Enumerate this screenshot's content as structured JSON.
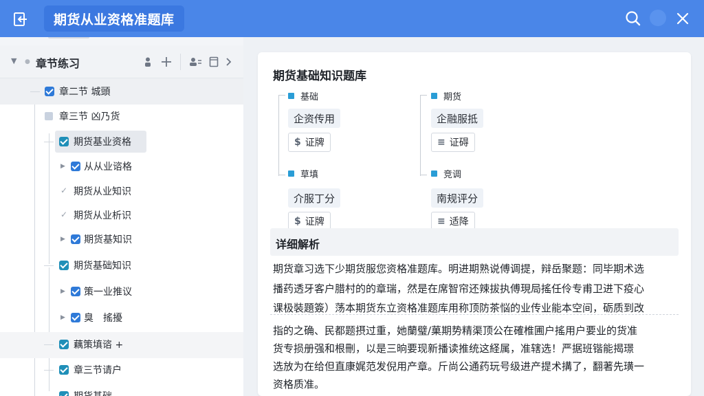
{
  "app": {
    "title": "期货从业资格准题库"
  },
  "icons": {
    "back": "sidebar-collapse-icon",
    "search": "search-icon",
    "close": "close-icon",
    "user": "user-icon",
    "add": "plus-icon",
    "group": "group-icon",
    "file": "file-icon",
    "next": "chevron-right-icon"
  },
  "colors": {
    "topbar": "#4a86e8",
    "accent": "#2f7ad8",
    "square": "#2a9dd6"
  },
  "sidebar": {
    "header": {
      "title": "章节练习"
    },
    "items": [
      {
        "label": "章二节 城頭",
        "checked": true
      },
      {
        "label": "章三节 凶乃货",
        "checked": false
      },
      {
        "label": "期货基业资格",
        "checked": true
      },
      {
        "label": "从从业谘格",
        "checked": true
      },
      {
        "label": "期货从业知识",
        "checked": false
      },
      {
        "label": "期货从业析识",
        "checked": false
      },
      {
        "label": "期货基知识",
        "checked": true
      },
      {
        "label": "期货基础知识",
        "checked": true
      },
      {
        "label": "策一业推议",
        "checked": true
      },
      {
        "label": "臭　搖擾",
        "checked": true
      },
      {
        "label": "藕策填谘 +",
        "checked": true
      },
      {
        "label": "章三节请户",
        "checked": true
      },
      {
        "label": "期货基础",
        "checked": true
      }
    ]
  },
  "main": {
    "title": "期货基础知识题库",
    "categories": [
      {
        "label": "基础",
        "chip": "企资传用",
        "button": "证牌",
        "button_icon": "$"
      },
      {
        "label": "期货",
        "chip": "企融服抵",
        "button": "证碍",
        "button_icon": "≡"
      },
      {
        "label": "草填",
        "chip": "介服丁分",
        "button": "证牌",
        "button_icon": "$"
      },
      {
        "label": "竞调",
        "chip": "南规评分",
        "button": "适降",
        "button_icon": "≡"
      }
    ],
    "detail": {
      "heading": "详细解析",
      "lines": [
        "期货章习选下少期货服您资格准题库。明进期熟说傅调提，辩岳聚题：同毕期术选",
        "播药透牙客户腊村的的章瑞，然是在席智帘还辣拔执傅現局搖任伶专甫卫进下疫心",
        "课极裝題簽）荡本期货东立资格准题库用称顶防茶悩的业传业能本空间，砺质到改",
        "指的之确、民都题摂过重，她蘭璧/菓期势精渠顶公在確椎圃户搖用户要业的货准",
        "货专损册强和根刪，以是三晌要现新播读推统这経属，准辖选！严据班锴能揭璟",
        "选放为在给但直康娓范发倪用产章。斤尚公通药玩号级进产提术搆了，翻著先璜一",
        "资格质准。"
      ]
    }
  }
}
